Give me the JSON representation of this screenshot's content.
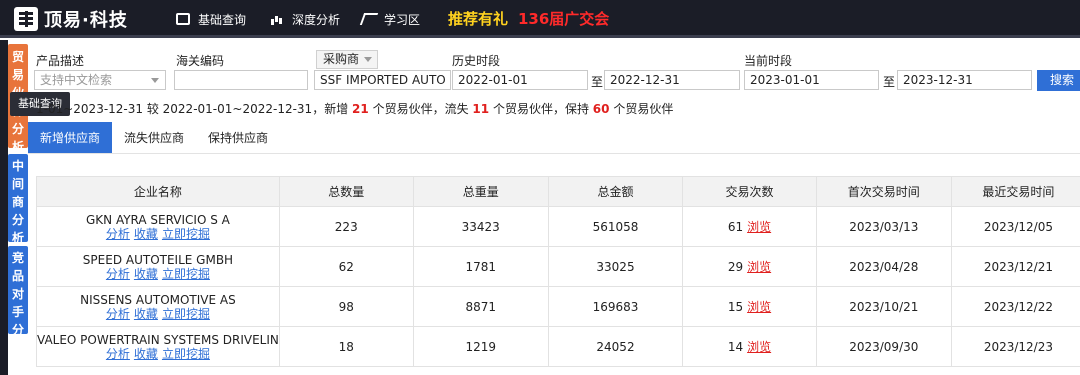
{
  "topbar": {
    "logo_text": "顶易·科技",
    "nav": [
      "基础查询",
      "深度分析",
      "学习区"
    ],
    "promo": "推荐有礼",
    "promo_red": "136届广交会"
  },
  "side_tabs": [
    {
      "label": "贸易伙伴分析"
    },
    {
      "label": "中间商分析"
    },
    {
      "label": "竞品对手分析"
    }
  ],
  "tooltip": "基础查询",
  "filters": {
    "product_label": "产品描述",
    "product_placeholder": "支持中文检索",
    "hs_label": "海关编码",
    "hs_value": "",
    "role_select": "采购商",
    "role_value": "SSF IMPORTED AUTO PA",
    "history_label": "历史时段",
    "history_from": "2022-01-01",
    "history_to": "2022-12-31",
    "current_label": "当前时段",
    "current_from": "2023-01-01",
    "current_to": "2023-12-31",
    "to_label": "至",
    "search_button": "搜索"
  },
  "summary": {
    "prefix": "1-01~2023-12-31 较 2022-01-01~2022-12-31，新增",
    "new_count": "21",
    "mid1": "个贸易伙伴，流失",
    "lost_count": "11",
    "mid2": "个贸易伙伴，保持",
    "kept_count": "60",
    "suffix": "个贸易伙伴"
  },
  "tabs": [
    "新增供应商",
    "流失供应商",
    "保持供应商"
  ],
  "table": {
    "headers": [
      "企业名称",
      "总数量",
      "总重量",
      "总金额",
      "交易次数",
      "首次交易时间",
      "最近交易时间"
    ],
    "link_labels": {
      "analyze": "分析",
      "favorite": "收藏",
      "mine": "立即挖掘",
      "browse": "浏览"
    },
    "rows": [
      {
        "name": "GKN AYRA SERVICIO S A",
        "qty": "223",
        "weight": "33423",
        "amount": "561058",
        "count": "61",
        "first": "2023/03/13",
        "last": "2023/12/05"
      },
      {
        "name": "SPEED AUTOTEILE GMBH",
        "qty": "62",
        "weight": "1781",
        "amount": "33025",
        "count": "29",
        "first": "2023/04/28",
        "last": "2023/12/21"
      },
      {
        "name": "NISSENS AUTOMOTIVE AS",
        "qty": "98",
        "weight": "8871",
        "amount": "169683",
        "count": "15",
        "first": "2023/10/21",
        "last": "2023/12/22"
      },
      {
        "name": "VALEO POWERTRAIN SYSTEMS DRIVELIN",
        "qty": "18",
        "weight": "1219",
        "amount": "24052",
        "count": "14",
        "first": "2023/09/30",
        "last": "2023/12/23"
      }
    ]
  }
}
